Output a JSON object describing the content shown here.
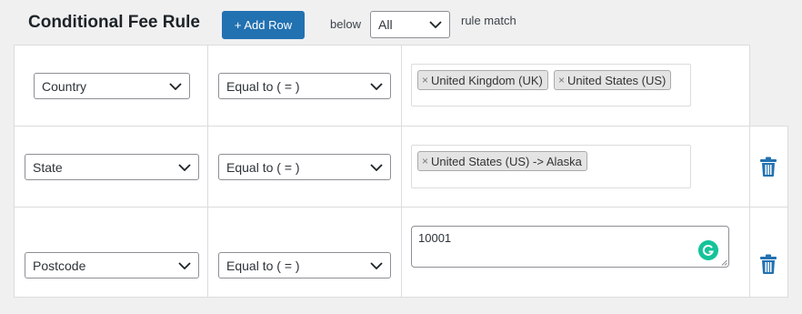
{
  "header": {
    "title": "Conditional Fee Rule",
    "add_row_label": "+ Add Row",
    "below_label": "below",
    "match_select_value": "All",
    "rule_match_label": "rule match"
  },
  "rows": [
    {
      "field_value": "Country",
      "operator_value": "Equal to ( = )",
      "tags": [
        {
          "remove": "×",
          "label": "United Kingdom (UK)"
        },
        {
          "remove": "×",
          "label": "United States (US)"
        }
      ]
    },
    {
      "field_value": "State",
      "operator_value": "Equal to ( = )",
      "tags": [
        {
          "remove": "×",
          "label": "United States (US) -> Alaska"
        }
      ]
    },
    {
      "field_value": "Postcode",
      "operator_value": "Equal to ( = )",
      "text_value": "10001"
    }
  ],
  "icons": {
    "chevron": "chevron-down-icon",
    "trash": "trash-icon",
    "grammarly": "grammarly-icon"
  },
  "colors": {
    "primary": "#2271b1",
    "trash": "#2271b1",
    "grammarly": "#15c39a"
  }
}
